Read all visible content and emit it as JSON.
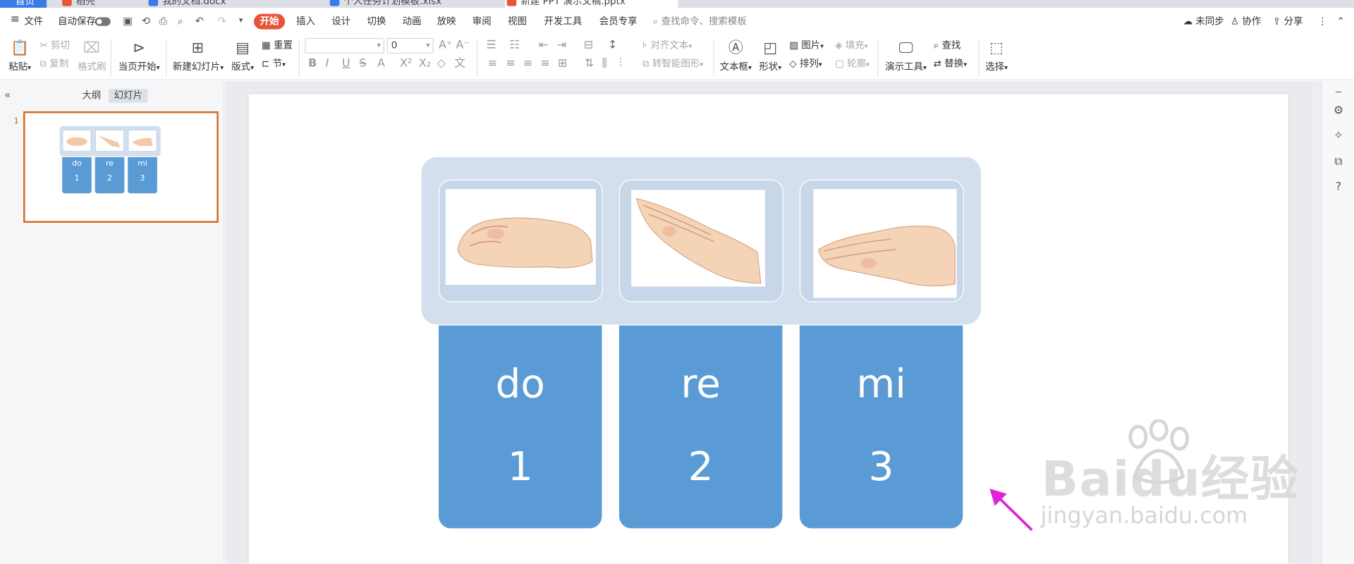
{
  "tabs": {
    "home": "首页",
    "doc1": "稻壳",
    "doc2": "我的文档.docx",
    "doc3": "个人任务计划模板.xlsx",
    "doc4": "新建 PPT 演示文稿.pptx"
  },
  "menu": {
    "file": "文件",
    "autosave": "自动保存",
    "tabs": [
      "开始",
      "插入",
      "设计",
      "切换",
      "动画",
      "放映",
      "审阅",
      "视图",
      "开发工具",
      "会员专享"
    ],
    "search_placeholder": "查找命令、搜索模板",
    "unsynced": "未同步",
    "collab": "协作",
    "share": "分享"
  },
  "ribbon": {
    "paste": "粘贴",
    "cut": "剪切",
    "copy": "复制",
    "format_painter": "格式刷",
    "from_current": "当页开始",
    "new_slide": "新建幻灯片",
    "layout": "版式",
    "reset": "重置",
    "section": "节",
    "font_size": "0",
    "align_text": "对齐文本",
    "smart_graphic": "转智能图形",
    "textbox": "文本框",
    "shape": "形状",
    "picture": "图片",
    "fill": "填充",
    "arrange": "排列",
    "outline": "轮廓",
    "present_tools": "演示工具",
    "find": "查找",
    "replace": "替换",
    "select": "选择"
  },
  "pane": {
    "outline_tab": "大纲",
    "slides_tab": "幻灯片",
    "slide_number": "1"
  },
  "slide": {
    "cards": [
      {
        "syllable": "do",
        "number": "1"
      },
      {
        "syllable": "re",
        "number": "2"
      },
      {
        "syllable": "mi",
        "number": "3"
      }
    ],
    "accent_color": "#5b9bd5",
    "band_color": "#d4dfee"
  },
  "watermark": {
    "brand": "Baidu经验",
    "url": "jingyan.baidu.com"
  }
}
